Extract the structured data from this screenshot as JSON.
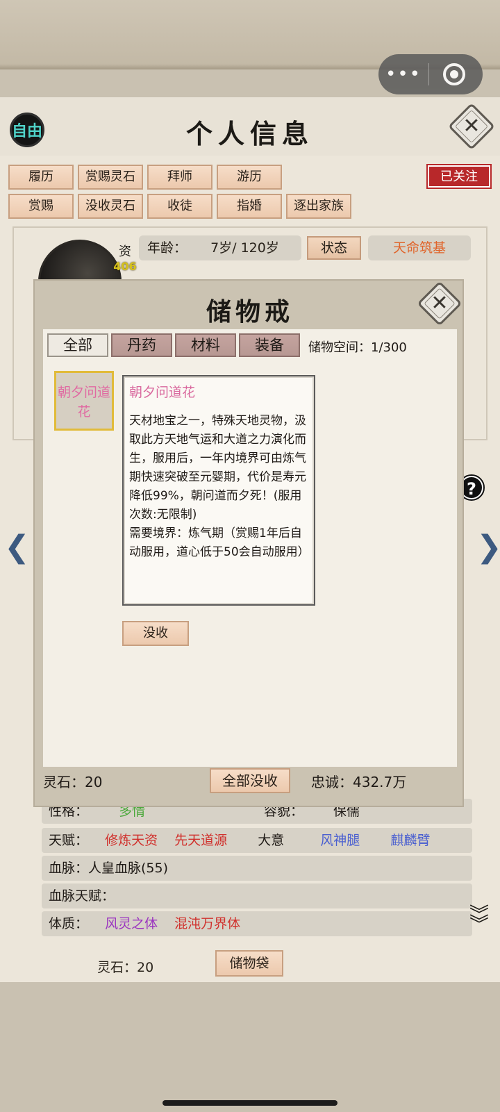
{
  "header": {
    "free_badge": "自由",
    "title": "个人信息"
  },
  "actions_row1": [
    "履历",
    "赏赐灵石",
    "拜师",
    "游历"
  ],
  "actions_row2": [
    "赏赐",
    "没收灵石",
    "收徒",
    "指婚",
    "逐出家族"
  ],
  "follow_button": "已关注",
  "profile": {
    "zi_label": "资",
    "zi_value": "406",
    "age_label": "年龄：",
    "age_value": "7岁/ 120岁",
    "status_button": "状态",
    "realm": "天命筑基"
  },
  "modal": {
    "title": "储物戒",
    "tabs": [
      "全部",
      "丹药",
      "材料",
      "装备"
    ],
    "active_tab": "全部",
    "capacity": "储物空间：1/300",
    "item_slot_label": "朝夕问道花",
    "item": {
      "name": "朝夕问道花",
      "description": "天材地宝之一，特殊天地灵物，汲取此方天地气运和大道之力演化而生，服用后，一年内境界可由炼气期快速突破至元婴期，代价是寿元降低99%，朝问道而夕死！(服用次数:无限制)\n需要境界：炼气期（赏赐1年后自动服用，道心低于50会自动服用）"
    },
    "confiscate_button": "没收",
    "footer_spirit_stone": "灵石：20",
    "confiscate_all_button": "全部没收",
    "loyalty": "忠诚：432.7万"
  },
  "traits": {
    "personality_label": "性格：",
    "personality_value": "多情",
    "appearance_label": "容貌：",
    "appearance_value": "保儒",
    "talent_label": "天赋：",
    "talents": [
      {
        "text": "修炼天资",
        "color": "#d0312d"
      },
      {
        "text": "先天道源",
        "color": "#d0312d"
      },
      {
        "text": "大意",
        "color": "#1f1a16"
      },
      {
        "text": "风神腿",
        "color": "#4a5fd0"
      },
      {
        "text": "麒麟臂",
        "color": "#4a5fd0"
      }
    ],
    "bloodline": "血脉：人皇血脉(55)",
    "bloodline_talent": "血脉天赋：",
    "physique_label": "体质：",
    "physiques": [
      {
        "text": "风灵之体",
        "color": "#9b34c0"
      },
      {
        "text": "混沌万界体",
        "color": "#d0312d"
      }
    ]
  },
  "bottom": {
    "spirit_stone": "灵石：20",
    "bag_button": "储物袋"
  }
}
